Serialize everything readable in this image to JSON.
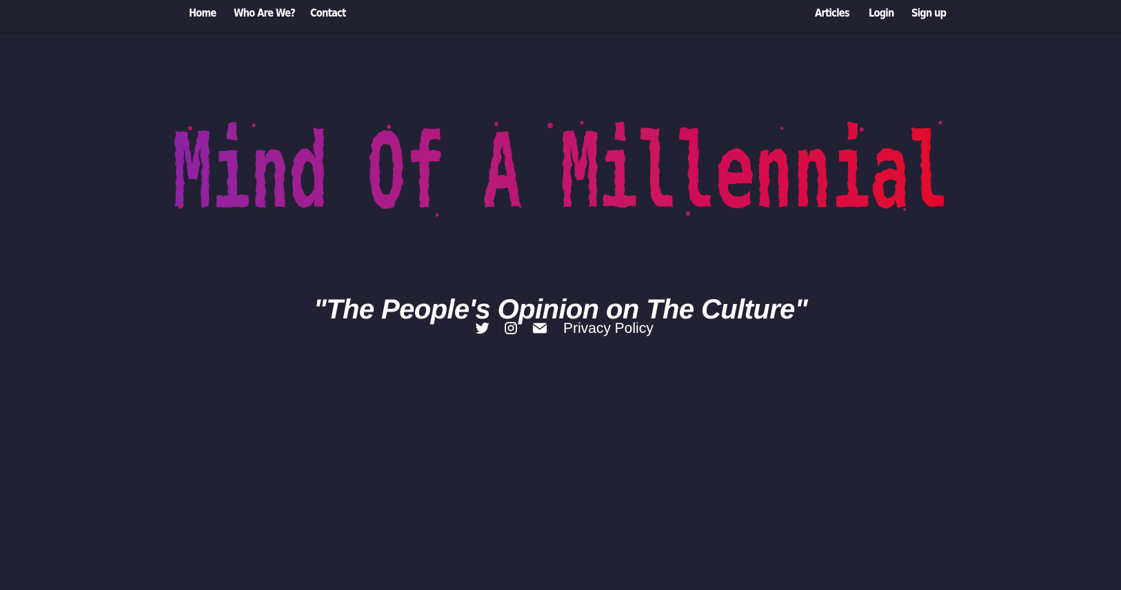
{
  "nav": {
    "left": [
      {
        "label": "Home"
      },
      {
        "label": "Who Are We?"
      },
      {
        "label": "Contact"
      }
    ],
    "right": [
      {
        "label": "Articles"
      },
      {
        "label": "Login"
      },
      {
        "label": "Sign up"
      }
    ]
  },
  "hero": {
    "logo_text": "Mind Of A Millennial",
    "logo_colors": [
      "#8e22a3",
      "#b01d82",
      "#d0115a",
      "#e3062b"
    ],
    "tagline": "\"The People's Opinion on The Culture\""
  },
  "social": {
    "icons": [
      "twitter-icon",
      "instagram-icon",
      "envelope-icon"
    ],
    "privacy_label": "Privacy Policy"
  },
  "colors": {
    "background": "#212133",
    "text": "#ffffff"
  }
}
